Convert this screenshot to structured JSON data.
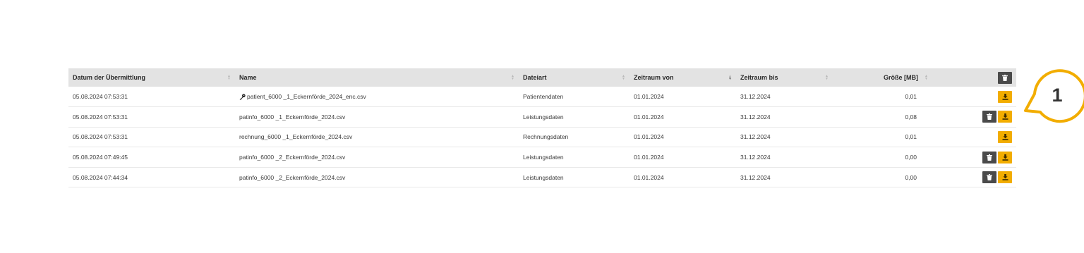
{
  "table": {
    "columns": [
      {
        "label": "Datum der Übermittlung"
      },
      {
        "label": "Name"
      },
      {
        "label": "Dateiart"
      },
      {
        "label": "Zeitraum von"
      },
      {
        "label": "Zeitraum bis"
      },
      {
        "label": "Größe [MB]"
      }
    ],
    "header_action_icon": "trash-icon",
    "rows": [
      {
        "datum": "05.08.2024 07:53:31",
        "name": "patient_6000 _1_Eckernförde_2024_enc.csv",
        "name_icon": "key-icon",
        "dateiart": "Patientendaten",
        "von": "01.01.2024",
        "bis": "31.12.2024",
        "groesse": "0,01",
        "delete": false,
        "download": true
      },
      {
        "datum": "05.08.2024 07:53:31",
        "name": "patinfo_6000 _1_Eckernförde_2024.csv",
        "dateiart": "Leistungsdaten",
        "von": "01.01.2024",
        "bis": "31.12.2024",
        "groesse": "0,08",
        "delete": true,
        "download": true
      },
      {
        "datum": "05.08.2024 07:53:31",
        "name": "rechnung_6000 _1_Eckernförde_2024.csv",
        "dateiart": "Rechnungsdaten",
        "von": "01.01.2024",
        "bis": "31.12.2024",
        "groesse": "0,01",
        "delete": false,
        "download": true
      },
      {
        "datum": "05.08.2024 07:49:45",
        "name": "patinfo_6000 _2_Eckernförde_2024.csv",
        "dateiart": "Leistungsdaten",
        "von": "01.01.2024",
        "bis": "31.12.2024",
        "groesse": "0,00",
        "delete": true,
        "download": true
      },
      {
        "datum": "05.08.2024 07:44:34",
        "name": "patinfo_6000 _2_Eckernförde_2024.csv",
        "dateiart": "Leistungsdaten",
        "von": "01.01.2024",
        "bis": "31.12.2024",
        "groesse": "0,00",
        "delete": true,
        "download": true
      }
    ]
  },
  "callout": {
    "number": "1"
  },
  "colors": {
    "download": "#f2ad00",
    "delete": "#4a4a4a",
    "header_bg": "#e3e3e3",
    "callout": "#f2ad00"
  }
}
